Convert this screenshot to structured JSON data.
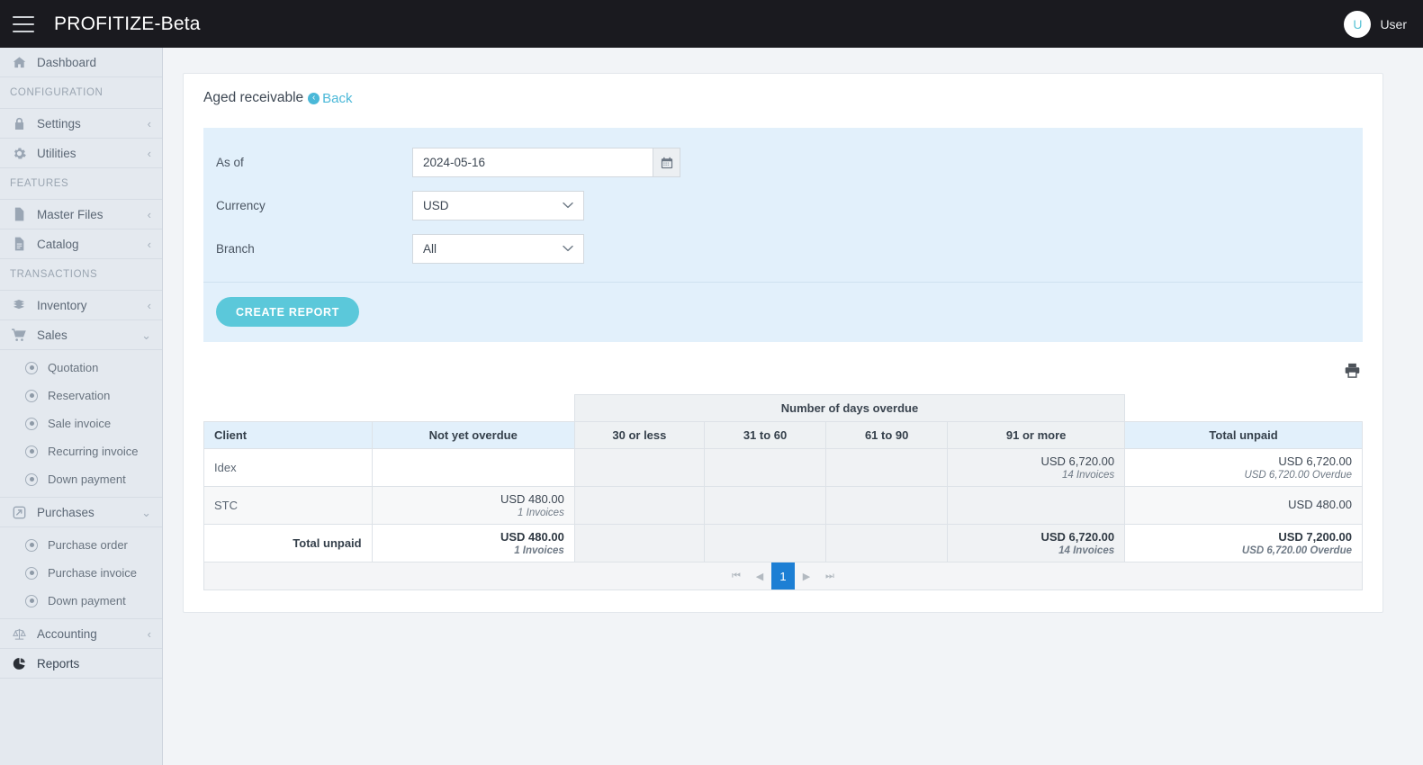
{
  "topbar": {
    "menu_icon": "hamburger-icon",
    "brand": "PROFITIZE-Beta",
    "avatar_initial": "U",
    "username": "User"
  },
  "sidebar": {
    "items": [
      {
        "label": "Dashboard",
        "icon": "home-icon",
        "type": "item",
        "chevron": ""
      },
      {
        "label": "CONFIGURATION",
        "type": "section"
      },
      {
        "label": "Settings",
        "icon": "lock-icon",
        "type": "item",
        "chevron": "‹"
      },
      {
        "label": "Utilities",
        "icon": "gear-icon",
        "type": "item",
        "chevron": "‹"
      },
      {
        "label": "FEATURES",
        "type": "section"
      },
      {
        "label": "Master Files",
        "icon": "file-icon",
        "type": "item",
        "chevron": "‹"
      },
      {
        "label": "Catalog",
        "icon": "file-lines-icon",
        "type": "item",
        "chevron": "‹"
      },
      {
        "label": "TRANSACTIONS",
        "type": "section"
      },
      {
        "label": "Inventory",
        "icon": "boxes-icon",
        "type": "item",
        "chevron": "‹"
      },
      {
        "label": "Sales",
        "icon": "cart-icon",
        "type": "item",
        "chevron": "⌄"
      }
    ],
    "sales_children": [
      "Quotation",
      "Reservation",
      "Sale invoice",
      "Recurring invoice",
      "Down payment"
    ],
    "purchases": {
      "label": "Purchases",
      "icon": "share-box-icon",
      "chevron": "⌄"
    },
    "purchases_children": [
      "Purchase order",
      "Purchase invoice",
      "Down payment"
    ],
    "tail_items": [
      {
        "label": "Accounting",
        "icon": "scales-icon",
        "chevron": "‹",
        "active": false
      },
      {
        "label": "Reports",
        "icon": "pie-chart-icon",
        "chevron": "",
        "active": true
      }
    ]
  },
  "page": {
    "title": "Aged receivable",
    "back_label": "Back",
    "back_icon": "arrow-left-circle-icon"
  },
  "filters": {
    "as_of": {
      "label": "As of",
      "value": "2024-05-16",
      "calendar_icon": "calendar-icon"
    },
    "currency": {
      "label": "Currency",
      "value": "USD"
    },
    "branch": {
      "label": "Branch",
      "value": "All"
    },
    "create_report_label": "CREATE REPORT"
  },
  "toolbar": {
    "print_icon": "printer-icon"
  },
  "table": {
    "group_header": "Number of days overdue",
    "columns": [
      "Client",
      "Not yet overdue",
      "30 or less",
      "31 to 60",
      "61 to 90",
      "91 or more",
      "Total unpaid"
    ],
    "rows": [
      {
        "client": "Idex",
        "not_yet_overdue": {
          "amount": "",
          "sub": ""
        },
        "d30": {
          "amount": "",
          "sub": ""
        },
        "d31_60": {
          "amount": "",
          "sub": ""
        },
        "d61_90": {
          "amount": "",
          "sub": ""
        },
        "d91": {
          "amount": "USD 6,720.00",
          "sub": "14 Invoices"
        },
        "total": {
          "amount": "USD 6,720.00",
          "sub": "USD 6,720.00 Overdue"
        }
      },
      {
        "client": "STC",
        "not_yet_overdue": {
          "amount": "USD 480.00",
          "sub": "1 Invoices"
        },
        "d30": {
          "amount": "",
          "sub": ""
        },
        "d31_60": {
          "amount": "",
          "sub": ""
        },
        "d61_90": {
          "amount": "",
          "sub": ""
        },
        "d91": {
          "amount": "",
          "sub": ""
        },
        "total": {
          "amount": "USD 480.00",
          "sub": ""
        }
      }
    ],
    "total_row": {
      "label": "Total unpaid",
      "not_yet_overdue": {
        "amount": "USD 480.00",
        "sub": "1 Invoices"
      },
      "d30": {
        "amount": "",
        "sub": ""
      },
      "d31_60": {
        "amount": "",
        "sub": ""
      },
      "d61_90": {
        "amount": "",
        "sub": ""
      },
      "d91": {
        "amount": "USD 6,720.00",
        "sub": "14 Invoices"
      },
      "total": {
        "amount": "USD 7,200.00",
        "sub": "USD 6,720.00 Overdue"
      }
    },
    "pagination": {
      "first": "⏮",
      "prev": "◀",
      "current": "1",
      "next": "▶",
      "last": "⏭"
    }
  },
  "colors": {
    "topbar_bg": "#1a1a1f",
    "sidebar_bg": "#e4e9ef",
    "accent": "#5bc8da",
    "link": "#4ab8d8",
    "filter_panel_bg": "#e2f0fb",
    "header_blue": "#e2f0fb",
    "header_gray": "#eef1f3",
    "pager_active": "#1d7fd4"
  }
}
